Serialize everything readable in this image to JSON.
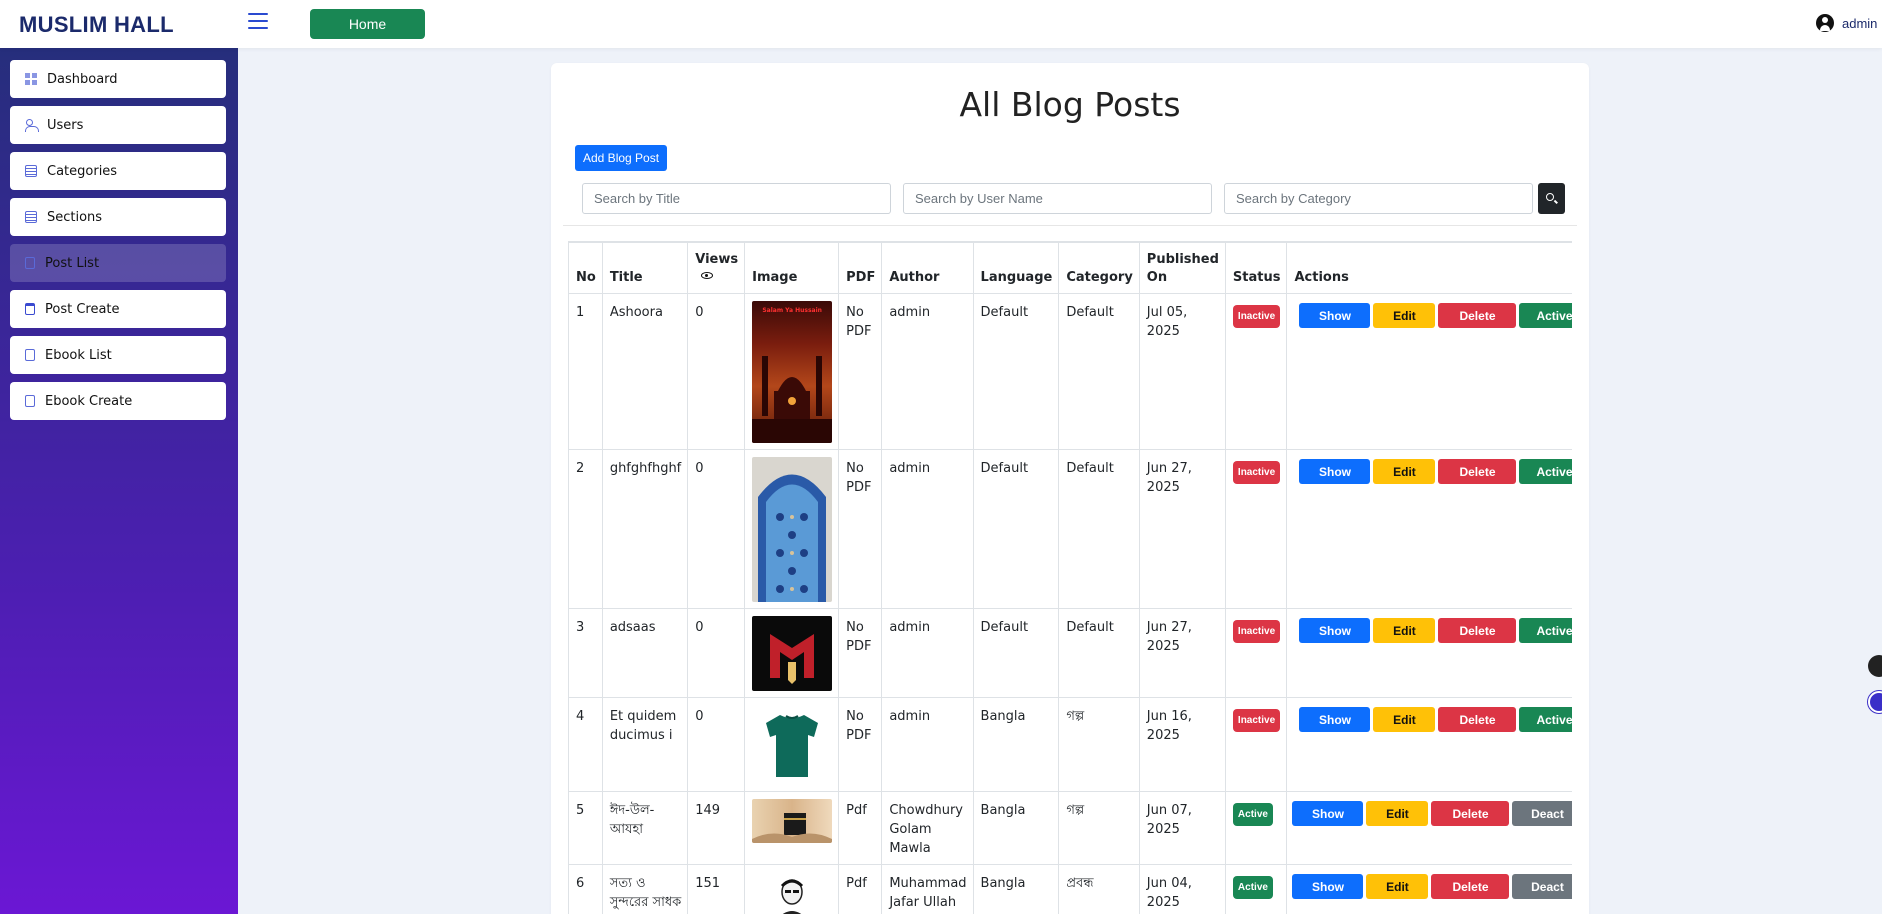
{
  "brand": "MUSLIM HALL",
  "topbar": {
    "home_label": "Home",
    "user_name": "admin"
  },
  "sidebar": {
    "items": [
      {
        "label": "Dashboard"
      },
      {
        "label": "Users"
      },
      {
        "label": "Categories"
      },
      {
        "label": "Sections"
      },
      {
        "label": "Post List"
      },
      {
        "label": "Post Create"
      },
      {
        "label": "Ebook List"
      },
      {
        "label": "Ebook Create"
      }
    ]
  },
  "main": {
    "title": "All Blog Posts",
    "add_button": "Add Blog Post",
    "search": {
      "title_placeholder": "Search by Title",
      "user_placeholder": "Search by User Name",
      "category_placeholder": "Search by Category"
    },
    "table": {
      "headers": {
        "no": "No",
        "title": "Title",
        "views": "Views",
        "image": "Image",
        "pdf": "PDF",
        "author": "Author",
        "language": "Language",
        "category": "Category",
        "published_line1": "Published",
        "published_line2": "On",
        "status": "Status",
        "actions": "Actions"
      },
      "action_labels": {
        "show": "Show",
        "edit": "Edit",
        "delete": "Delete",
        "activate": "Active",
        "deactivate": "Deact"
      },
      "rows": [
        {
          "no": "1",
          "title": "Ashoora",
          "views": "0",
          "image": "red-mosque-poster",
          "image_caption": "Salam Ya Hussain",
          "pdf": "No PDF",
          "author": "admin",
          "language": "Default",
          "category": "Default",
          "published": "Jul 05, 2025",
          "status": "Inactive"
        },
        {
          "no": "2",
          "title": "ghfghfhghf",
          "views": "0",
          "image": "tiled-arch-mihrab",
          "pdf": "No PDF",
          "author": "admin",
          "language": "Default",
          "category": "Default",
          "published": "Jun 27, 2025",
          "status": "Inactive"
        },
        {
          "no": "3",
          "title": "adsaas",
          "views": "0",
          "image": "red-m-logo",
          "pdf": "No PDF",
          "author": "admin",
          "language": "Default",
          "category": "Default",
          "published": "Jun 27, 2025",
          "status": "Inactive"
        },
        {
          "no": "4",
          "title": "Et quidem ducimus i",
          "views": "0",
          "image": "green-tshirt",
          "pdf": "No PDF",
          "author": "admin",
          "language": "Bangla",
          "category": "গল্প",
          "published": "Jun 16, 2025",
          "status": "Inactive"
        },
        {
          "no": "5",
          "title": "ঈদ-উল-আযহা",
          "views": "149",
          "image": "kaaba-painting",
          "pdf": "Pdf",
          "author": "Chowdhury Golam Mawla",
          "language": "Bangla",
          "category": "গল্প",
          "published": "Jun 07, 2025",
          "status": "Active"
        },
        {
          "no": "6",
          "title": "সত্য ও সুন্দরের সাধক",
          "views": "151",
          "image": "portrait-sketch",
          "pdf": "Pdf",
          "author": "Muhammad Jafar Ullah",
          "language": "Bangla",
          "category": "প্রবন্ধ",
          "published": "Jun 04, 2025",
          "status": "Active"
        }
      ]
    }
  },
  "colors": {
    "brand_text": "#1b2a6b",
    "primary": "#0d6efd",
    "success": "#198754",
    "warning": "#ffc107",
    "danger": "#dc3545",
    "secondary": "#6c757d",
    "sidebar_top": "#262e7c",
    "sidebar_bottom": "#6b17d4"
  }
}
